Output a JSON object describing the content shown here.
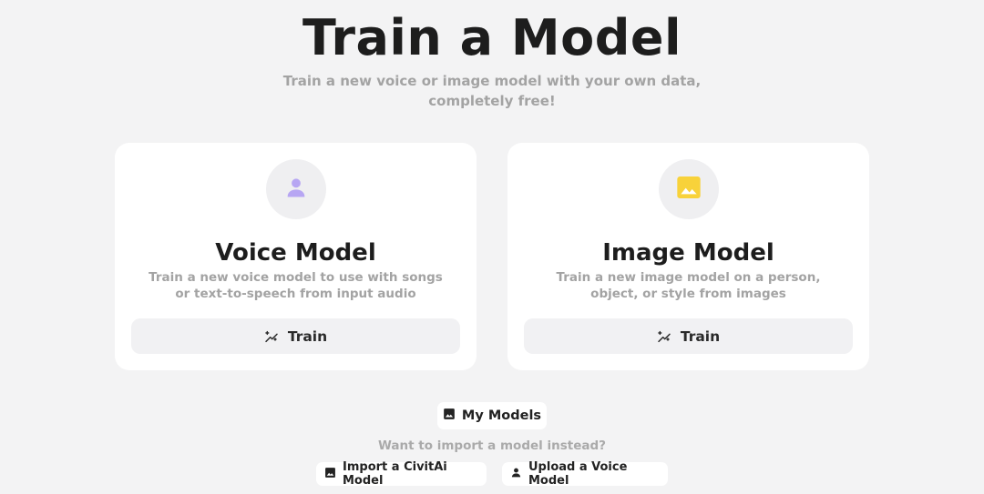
{
  "header": {
    "title": "Train a Model",
    "subtitle": "Train a new voice or image model with your own data, completely free!"
  },
  "cards": [
    {
      "icon": "person-icon",
      "icon_color": "#b7a6f3",
      "title": "Voice Model",
      "description": "Train a new voice model to use with songs or text-to-speech from input audio",
      "button_label": "Train"
    },
    {
      "icon": "image-icon",
      "icon_color": "#f8d23a",
      "title": "Image Model",
      "description": "Train a new image model on a person, object, or style from images",
      "button_label": "Train"
    }
  ],
  "footer": {
    "my_models_label": "My Models",
    "import_prompt": "Want to import a model instead?",
    "import_civitai_label": "Import a CivitAi Model",
    "upload_voice_label": "Upload a Voice Model"
  },
  "colors": {
    "background": "#f3f3f4",
    "card": "#ffffff",
    "muted_text": "#a3a3a3",
    "button_bg": "#f1f1f3"
  }
}
